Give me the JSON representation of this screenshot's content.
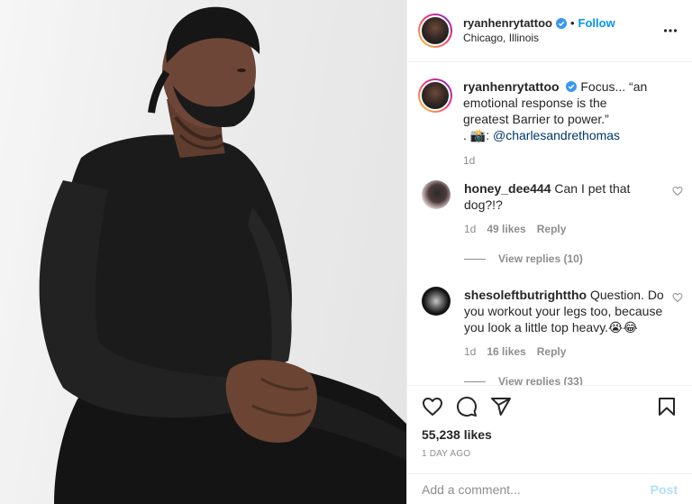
{
  "post": {
    "author": {
      "username": "ryanhenrytattoo",
      "location": "Chicago, Illinois",
      "follow_label": "Follow",
      "separator": "•"
    },
    "caption": {
      "username": "ryanhenrytattoo",
      "text": "Focus... “an emotional response is the greatest Barrier to power.”",
      "credit_prefix": ". 📸:",
      "mention": "@charlesandrethomas",
      "age": "1d"
    },
    "comments": [
      {
        "username": "honey_dee444",
        "text": "Can I pet that dog?!?",
        "age": "1d",
        "likes": "49 likes",
        "reply_label": "Reply",
        "view_replies": "View replies (10)"
      },
      {
        "username": "shesoleftbutrighttho",
        "text": "Question. Do you workout your legs too, because you look a little top heavy.😭😂",
        "age": "1d",
        "likes": "16 likes",
        "reply_label": "Reply",
        "view_replies": "View replies (33)"
      }
    ],
    "likes_count": "55,238 likes",
    "posted_time": "1 DAY AGO",
    "comment_input": {
      "placeholder": "Add a comment...",
      "value": ""
    },
    "post_button": "Post"
  },
  "icons": {
    "more": "more-options-icon",
    "verified": "verified-badge-icon",
    "like": "heart-icon",
    "comment": "comment-icon",
    "share": "paper-plane-icon",
    "save": "bookmark-icon",
    "comment_like": "small-heart-icon"
  },
  "colors": {
    "accent": "#0095f6",
    "verified": "#3897f0",
    "muted": "#8e8e8e",
    "text": "#262626",
    "post_disabled": "#b2dffc"
  }
}
